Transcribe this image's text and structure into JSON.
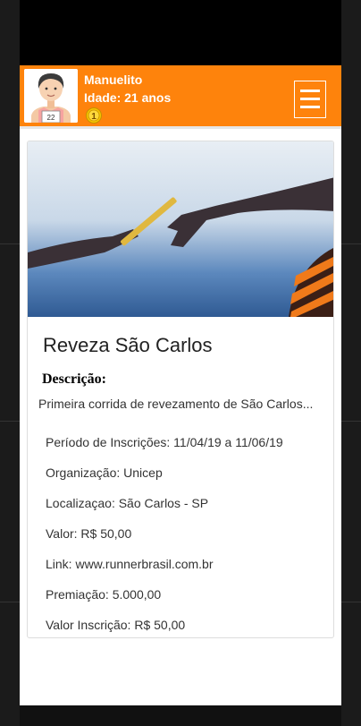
{
  "profile": {
    "name": "Manuelito",
    "age": "Idade: 21 anos",
    "bib_number": "22",
    "medal_number": "1"
  },
  "event": {
    "title": "Reveza São Carlos",
    "description_label": "Descrição:",
    "description": "Primeira corrida de revezamento de São Carlos...",
    "details": [
      "Período de Inscrições: 11/04/19 a 11/06/19",
      "Organização: Unicep",
      "Localizaçao: São Carlos - SP",
      "Valor: R$ 50,00",
      "Link: www.runnerbrasil.com.br",
      "Premiação: 5.000,00",
      "Valor Inscrição: R$ 50,00"
    ]
  },
  "colors": {
    "header": "#fe830c",
    "medal": "#f5c400"
  },
  "icons": {
    "menu": "hamburger-menu-icon",
    "medal": "medal-icon"
  }
}
